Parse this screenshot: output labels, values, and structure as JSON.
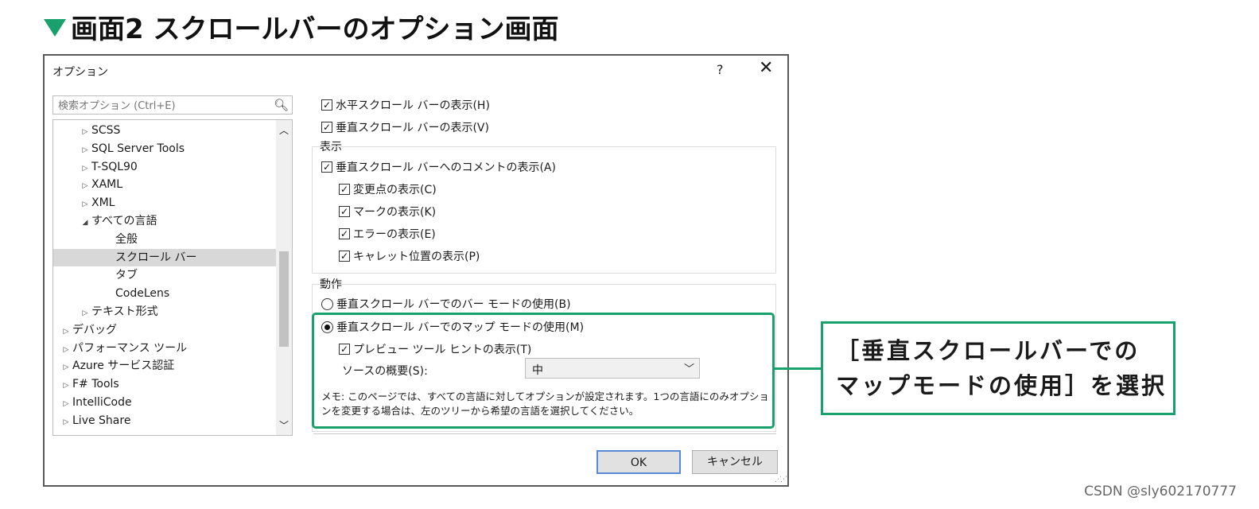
{
  "heading": "画面2 スクロールバーのオプション画面",
  "dialog": {
    "title": "オプション",
    "help": "?",
    "close": "✕",
    "search": {
      "placeholder": "検索オプション (Ctrl+E)",
      "icon": "search-icon"
    },
    "tree": [
      {
        "label": "SCSS",
        "indent": 1,
        "arrow": "▷",
        "selected": false
      },
      {
        "label": "SQL Server Tools",
        "indent": 1,
        "arrow": "▷",
        "selected": false
      },
      {
        "label": "T-SQL90",
        "indent": 1,
        "arrow": "▷",
        "selected": false
      },
      {
        "label": "XAML",
        "indent": 1,
        "arrow": "▷",
        "selected": false
      },
      {
        "label": "XML",
        "indent": 1,
        "arrow": "▷",
        "selected": false
      },
      {
        "label": "すべての言語",
        "indent": 1,
        "arrow": "◢",
        "selected": false
      },
      {
        "label": "全般",
        "indent": 2,
        "arrow": "",
        "selected": false
      },
      {
        "label": "スクロール バー",
        "indent": 2,
        "arrow": "",
        "selected": true
      },
      {
        "label": "タブ",
        "indent": 2,
        "arrow": "",
        "selected": false
      },
      {
        "label": "CodeLens",
        "indent": 2,
        "arrow": "",
        "selected": false
      },
      {
        "label": "テキスト形式",
        "indent": 1,
        "arrow": "▷",
        "selected": false
      },
      {
        "label": "デバッグ",
        "indent": 0,
        "arrow": "▷",
        "selected": false
      },
      {
        "label": "パフォーマンス ツール",
        "indent": 0,
        "arrow": "▷",
        "selected": false
      },
      {
        "label": "Azure サービス認証",
        "indent": 0,
        "arrow": "▷",
        "selected": false
      },
      {
        "label": "F# Tools",
        "indent": 0,
        "arrow": "▷",
        "selected": false
      },
      {
        "label": "IntelliCode",
        "indent": 0,
        "arrow": "▷",
        "selected": false
      },
      {
        "label": "Live Share",
        "indent": 0,
        "arrow": "▷",
        "selected": false
      }
    ],
    "options": {
      "show_horizontal": "水平スクロール バーの表示(H)",
      "show_vertical": "垂直スクロール バーの表示(V)",
      "display_group": "表示",
      "show_annotations": "垂直スクロール バーへのコメントの表示(A)",
      "show_changes": "変更点の表示(C)",
      "show_marks": "マークの表示(K)",
      "show_errors": "エラーの表示(E)",
      "show_caret": "キャレット位置の表示(P)",
      "behavior_group": "動作",
      "bar_mode": "垂直スクロール バーでのバー モードの使用(B)",
      "map_mode": "垂直スクロール バーでのマップ モードの使用(M)",
      "preview_tooltip": "プレビュー ツール ヒントの表示(T)",
      "source_overview_label": "ソースの概要(S):",
      "source_overview_value": "中",
      "note": "メモ: このページでは、すべての言語に対してオプションが設定されます。1つの言語にのみオプションを変更する場合は、左のツリーから希望の言語を選択してください。"
    },
    "check_mark": "✓",
    "ok": "OK",
    "cancel": "キャンセル"
  },
  "callout": {
    "line1": "［垂直スクロールバーでの",
    "line2": "マップモードの使用］を選択"
  },
  "footer": "CSDN @sly602170777",
  "colors": {
    "accent": "#1aa06c"
  }
}
